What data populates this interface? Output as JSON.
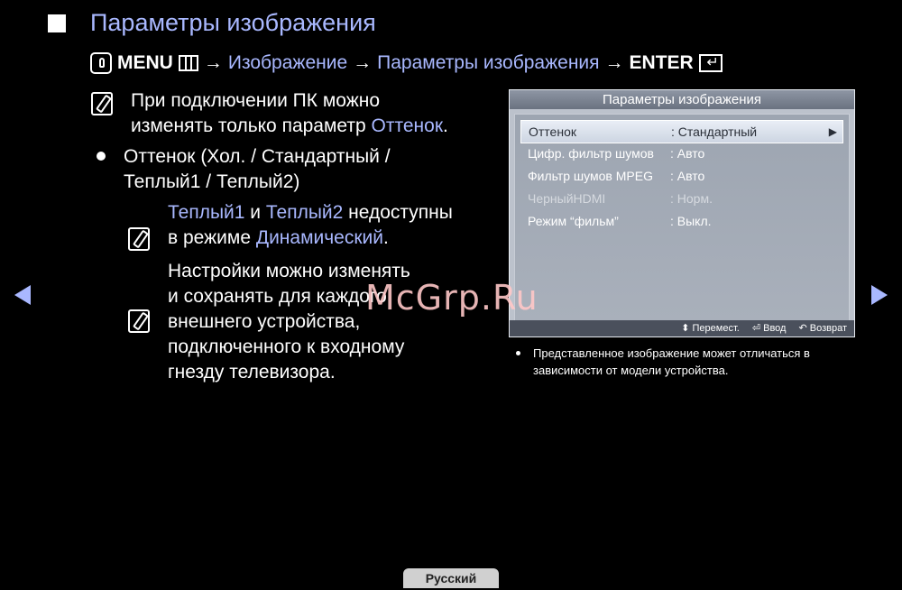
{
  "title": "Параметры изображения",
  "menu_path": {
    "menu": "MENU",
    "arrow1": "→",
    "item1": "Изображение",
    "arrow2": "→",
    "item2": "Параметры изображения",
    "arrow3": "→",
    "enter": "ENTER"
  },
  "note1": {
    "line1": "При подключении ПК можно",
    "line2_prefix": "изменять только параметр ",
    "line2_highlight": "Оттенок",
    "line2_suffix": "."
  },
  "bullet": {
    "line1": "Оттенок (Хол. / Стандартный /",
    "line2": "Теплый1 / Теплый2)"
  },
  "note2": {
    "hl1": "Теплый1",
    "and": " и ",
    "hl2": "Теплый2",
    "rest1": " недоступны",
    "line2_prefix": "в режиме ",
    "hl3": "Динамический",
    "line2_suffix": "."
  },
  "note3": {
    "lines": [
      "Настройки можно изменять",
      "и сохранять для каждого",
      "внешнего устройства,",
      "подключенного к входному",
      "гнезду телевизора."
    ]
  },
  "osd": {
    "header": "Параметры изображения",
    "rows": [
      {
        "label": "Оттенок",
        "value": ": Стандартный",
        "state": "selected"
      },
      {
        "label": "Цифр. фильтр шумов",
        "value": ": Авто",
        "state": "normal"
      },
      {
        "label": "Фильтр шумов MPEG",
        "value": ": Авто",
        "state": "normal"
      },
      {
        "label": "ЧерныйHDMI",
        "value": ": Норм.",
        "state": "disabled"
      },
      {
        "label": "Режим “фильм”",
        "value": ": Выкл.",
        "state": "normal"
      }
    ],
    "footer": {
      "move": "Перемест.",
      "enter": "Ввод",
      "back": "Возврат"
    }
  },
  "disclaimer": {
    "line1": "Представленное изображение может отличаться в",
    "line2": "зависимости от модели устройства."
  },
  "language": "Русский",
  "watermark": "McGrp.Ru",
  "colors": {
    "accent": "#a9b8ff",
    "background": "#000000"
  }
}
